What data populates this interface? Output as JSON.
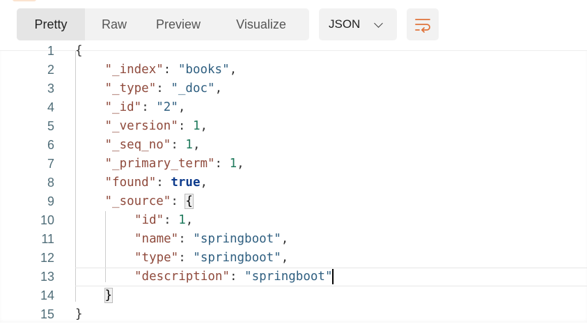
{
  "tabs": [
    {
      "label": "Pretty",
      "active": true
    },
    {
      "label": "Raw"
    },
    {
      "label": "Preview"
    },
    {
      "label": "Visualize"
    }
  ],
  "format": {
    "selected": "JSON"
  },
  "wrap_button": {
    "icon": "wrap-lines-icon",
    "color": "#e0733a"
  },
  "code": {
    "cursor_line": 13,
    "lines": [
      {
        "n": "1",
        "indent": 0,
        "tokens": [
          [
            "p",
            "{"
          ]
        ]
      },
      {
        "n": "2",
        "indent": 1,
        "tokens": [
          [
            "k",
            "\"_index\""
          ],
          [
            "p",
            ": "
          ],
          [
            "s",
            "\"books\""
          ],
          [
            "p",
            ","
          ]
        ]
      },
      {
        "n": "3",
        "indent": 1,
        "tokens": [
          [
            "k",
            "\"_type\""
          ],
          [
            "p",
            ": "
          ],
          [
            "s",
            "\"_doc\""
          ],
          [
            "p",
            ","
          ]
        ]
      },
      {
        "n": "4",
        "indent": 1,
        "tokens": [
          [
            "k",
            "\"_id\""
          ],
          [
            "p",
            ": "
          ],
          [
            "s",
            "\"2\""
          ],
          [
            "p",
            ","
          ]
        ]
      },
      {
        "n": "5",
        "indent": 1,
        "tokens": [
          [
            "k",
            "\"_version\""
          ],
          [
            "p",
            ": "
          ],
          [
            "n",
            "1"
          ],
          [
            "p",
            ","
          ]
        ]
      },
      {
        "n": "6",
        "indent": 1,
        "tokens": [
          [
            "k",
            "\"_seq_no\""
          ],
          [
            "p",
            ": "
          ],
          [
            "n",
            "1"
          ],
          [
            "p",
            ","
          ]
        ]
      },
      {
        "n": "7",
        "indent": 1,
        "tokens": [
          [
            "k",
            "\"_primary_term\""
          ],
          [
            "p",
            ": "
          ],
          [
            "n",
            "1"
          ],
          [
            "p",
            ","
          ]
        ]
      },
      {
        "n": "8",
        "indent": 1,
        "tokens": [
          [
            "k",
            "\"found\""
          ],
          [
            "p",
            ": "
          ],
          [
            "b",
            "true"
          ],
          [
            "p",
            ","
          ]
        ]
      },
      {
        "n": "9",
        "indent": 1,
        "tokens": [
          [
            "k",
            "\"_source\""
          ],
          [
            "p",
            ": "
          ],
          [
            "hb",
            "{"
          ]
        ]
      },
      {
        "n": "10",
        "indent": 2,
        "tokens": [
          [
            "k",
            "\"id\""
          ],
          [
            "p",
            ": "
          ],
          [
            "n",
            "1"
          ],
          [
            "p",
            ","
          ]
        ]
      },
      {
        "n": "11",
        "indent": 2,
        "tokens": [
          [
            "k",
            "\"name\""
          ],
          [
            "p",
            ": "
          ],
          [
            "s",
            "\"springboot\""
          ],
          [
            "p",
            ","
          ]
        ]
      },
      {
        "n": "12",
        "indent": 2,
        "tokens": [
          [
            "k",
            "\"type\""
          ],
          [
            "p",
            ": "
          ],
          [
            "s",
            "\"springboot\""
          ],
          [
            "p",
            ","
          ]
        ]
      },
      {
        "n": "13",
        "indent": 2,
        "tokens": [
          [
            "k",
            "\"description\""
          ],
          [
            "p",
            ": "
          ],
          [
            "s",
            "\"springboot\""
          ]
        ]
      },
      {
        "n": "14",
        "indent": 1,
        "tokens": [
          [
            "hb",
            "}"
          ]
        ]
      },
      {
        "n": "15",
        "indent": 0,
        "tokens": [
          [
            "p",
            "}"
          ]
        ]
      }
    ]
  }
}
